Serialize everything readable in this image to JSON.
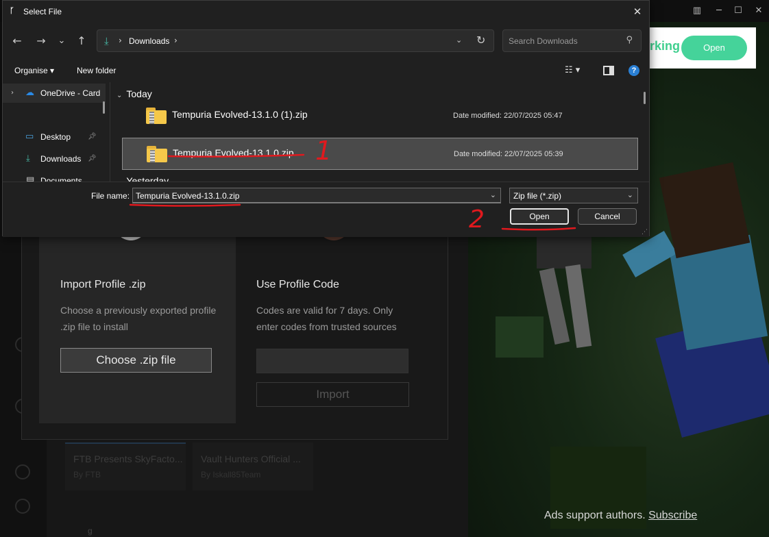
{
  "dialog": {
    "title": "Select File",
    "close_glyph": "✕",
    "nav": {
      "back": "←",
      "forward": "→",
      "recent": "⌄",
      "up": "↑"
    },
    "address": {
      "crumb": "Downloads",
      "sep": "›"
    },
    "search": {
      "placeholder": "Search Downloads"
    },
    "toolbar": {
      "organise": "Organise ▾",
      "new_folder": "New folder",
      "help": "?"
    },
    "nav_pane": {
      "onedrive": "OneDrive - Card",
      "desktop": "Desktop",
      "downloads": "Downloads",
      "documents": "Documents"
    },
    "groups": {
      "today": "Today",
      "yesterday": "Yesterday"
    },
    "files": [
      {
        "name": "Tempuria Evolved-13.1.0 (1).zip",
        "meta": "Date modified: 22/07/2025 05:47"
      },
      {
        "name": "Tempuria Evolved-13.1.0.zip",
        "meta": "Date modified: 22/07/2025 05:39"
      }
    ],
    "bottom": {
      "file_name_label": "File name:",
      "file_name_value": "Tempuria Evolved-13.1.0.zip",
      "file_type": "Zip file (*.zip)",
      "open": "Open",
      "cancel": "Cancel"
    }
  },
  "annotations": {
    "step1": "1",
    "step2": "2"
  },
  "modal": {
    "import": {
      "title": "Import Profile .zip",
      "desc": "Choose a previously exported profile .zip file to install",
      "button": "Choose .zip file"
    },
    "code": {
      "title": "Use Profile Code",
      "desc": "Codes are valid for 7 days. Only enter codes from trusted sources",
      "button": "Import"
    }
  },
  "background": {
    "cards": [
      {
        "title": "FTB Presents SkyFacto...",
        "author": "By FTB"
      },
      {
        "title": "Vault Hunters Official ...",
        "author": "By Iskall85Team"
      }
    ],
    "ad_banner_text": "rking",
    "ad_banner_button": "Open",
    "ads_support": "Ads support authors.",
    "subscribe": "Subscribe",
    "bottom_text": "g"
  },
  "colors": {
    "accent": "#2a7fd4",
    "annotation": "#e0191e",
    "ad_green": "#45d39a"
  }
}
